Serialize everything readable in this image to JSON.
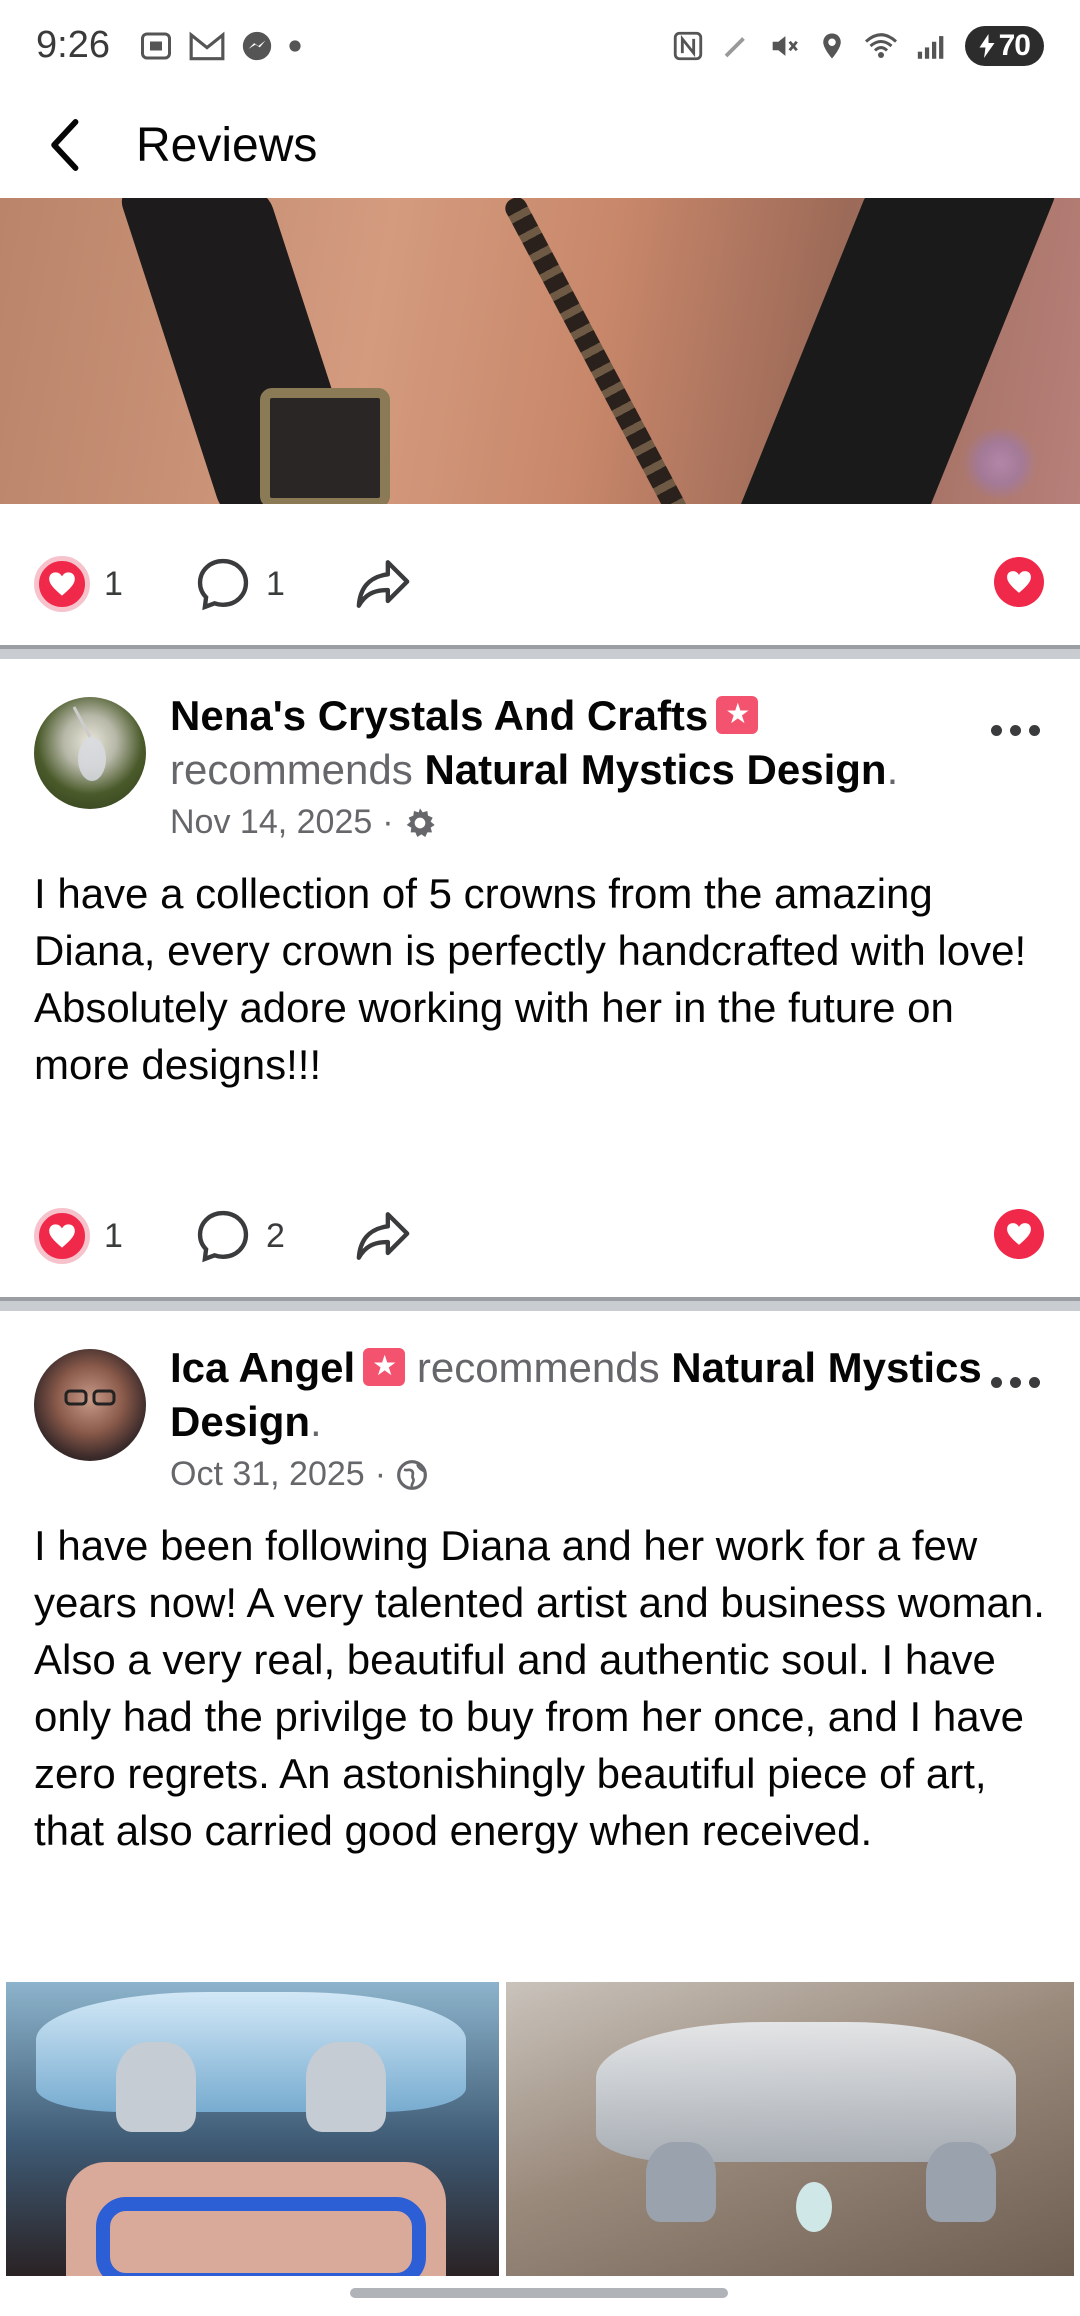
{
  "status_bar": {
    "time": "9:26",
    "battery": "70"
  },
  "app_bar": {
    "title": "Reviews"
  },
  "first_post_actions": {
    "likes": "1",
    "comments": "1"
  },
  "reviews": [
    {
      "author": "Nena's Crystals And Crafts",
      "recommends_text": "recommends",
      "page": "Natural Mystics Design",
      "date": "Nov 14, 2025",
      "privacy_icon": "gear-icon",
      "text": "I have a collection of 5 crowns from the amazing Diana, every crown is perfectly handcrafted with love! Absolutely adore working with her in the future on more designs!!!",
      "likes": "1",
      "comments": "2"
    },
    {
      "author": "Ica Angel",
      "recommends_text": "recommends",
      "page": "Natural Mystics Design",
      "date": "Oct 31, 2025",
      "privacy_icon": "globe-icon",
      "text": "I have been following Diana and her work for a few years now! A very talented artist and business woman. Also a very real, beautiful and authentic soul. I have only had the privilge to buy from her once, and I have zero regrets. An astonishingly beautiful piece of art, that also carried good energy when received."
    }
  ],
  "colors": {
    "reaction_red": "#f02849",
    "secondary_text": "#65676b"
  }
}
